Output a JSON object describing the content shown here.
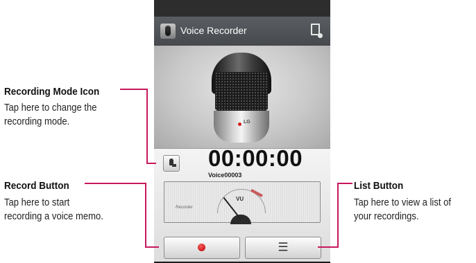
{
  "callouts": {
    "recording_mode": {
      "title": "Recording Mode Icon",
      "desc_line1": "Tap here to change the",
      "desc_line2": "recording mode."
    },
    "record_button": {
      "title": "Record Button",
      "desc_line1": "Tap here to start",
      "desc_line2": "recording a voice memo."
    },
    "list_button": {
      "title": "List Button",
      "desc_line1": "Tap here to view a list of",
      "desc_line2": "your recordings."
    }
  },
  "app": {
    "title": "Voice Recorder",
    "icon": "microphone-app-icon",
    "action_icon": "file-settings-icon"
  },
  "recorder": {
    "timer": "00:00:00",
    "filename": "Voice00003",
    "vu_label": "VU",
    "mic_brand": "LG",
    "vu_brand": "Recorder",
    "mode_icon": "recording-mode-icon",
    "record_icon": "record-dot-icon",
    "list_icon": "list-icon"
  },
  "colors": {
    "callout_line": "#c8175d",
    "record_dot": "#d41a1a",
    "app_bar": "#505357"
  }
}
